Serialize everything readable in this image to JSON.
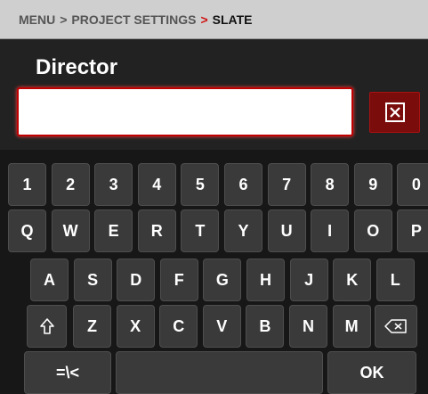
{
  "breadcrumb": {
    "items": [
      "MENU",
      "PROJECT SETTINGS",
      "SLATE"
    ],
    "separator": ">"
  },
  "field": {
    "label": "Director",
    "value": ""
  },
  "keyboard": {
    "row1": [
      "1",
      "2",
      "3",
      "4",
      "5",
      "6",
      "7",
      "8",
      "9",
      "0"
    ],
    "row2": [
      "Q",
      "W",
      "E",
      "R",
      "T",
      "Y",
      "U",
      "I",
      "O",
      "P"
    ],
    "row3": [
      "A",
      "S",
      "D",
      "F",
      "G",
      "H",
      "J",
      "K",
      "L"
    ],
    "row4": [
      "Z",
      "X",
      "C",
      "V",
      "B",
      "N",
      "M"
    ],
    "symbols_label": "=\\<",
    "ok_label": "OK",
    "icons": {
      "shift": "shift-arrow-icon",
      "backspace": "backspace-icon",
      "clear": "clear-x-icon"
    }
  },
  "colors": {
    "accent": "#c00000",
    "breadcrumb_bg": "#cfcfcf",
    "key_bg": "#3a3a3a",
    "background": "#181818"
  }
}
